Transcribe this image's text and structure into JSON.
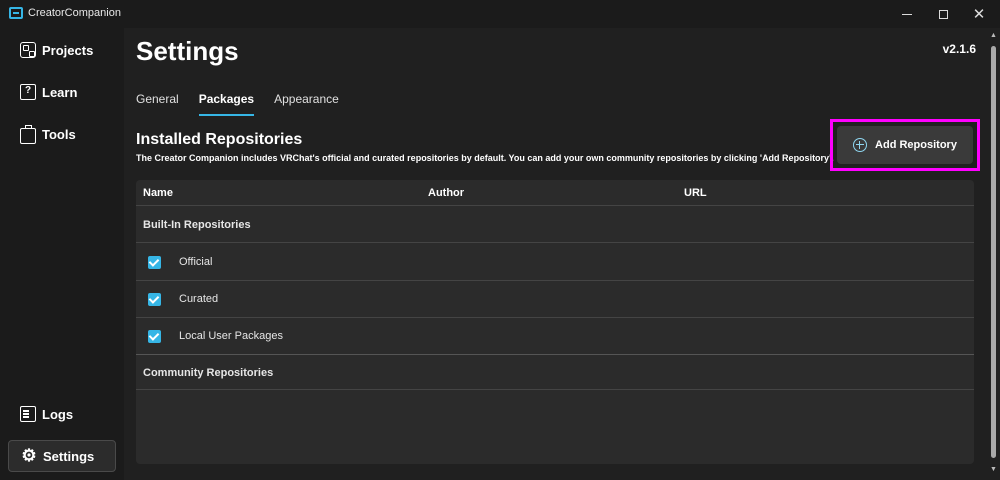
{
  "window": {
    "title": "CreatorCompanion",
    "minimize_icon": "minimize-icon",
    "maximize_icon": "maximize-icon",
    "close_icon": "close-icon"
  },
  "sidebar": {
    "items": [
      {
        "label": "Projects",
        "icon": "grid-icon"
      },
      {
        "label": "Learn",
        "icon": "book-icon"
      },
      {
        "label": "Tools",
        "icon": "toolbox-icon"
      },
      {
        "label": "Logs",
        "icon": "logs-icon"
      },
      {
        "label": "Settings",
        "icon": "gear-icon",
        "active": true
      }
    ]
  },
  "header": {
    "title": "Settings",
    "version": "v2.1.6"
  },
  "tabs": [
    {
      "label": "General"
    },
    {
      "label": "Packages",
      "active": true
    },
    {
      "label": "Appearance"
    }
  ],
  "repositories": {
    "title": "Installed Repositories",
    "description": "The Creator Companion includes VRChat's official and curated repositories by default. You can add your own community repositories by clicking 'Add Repository'.",
    "add_button_label": "Add Repository",
    "columns": [
      "Name",
      "Author",
      "URL"
    ],
    "builtin_label": "Built-In Repositories",
    "builtin": [
      {
        "name": "Official",
        "checked": true
      },
      {
        "name": "Curated",
        "checked": true
      },
      {
        "name": "Local User Packages",
        "checked": true
      }
    ],
    "community_label": "Community Repositories"
  },
  "colors": {
    "accent": "#36b6e6",
    "highlight": "#ff00ff",
    "background": "#202020",
    "sidebar": "#1b1b1b"
  }
}
